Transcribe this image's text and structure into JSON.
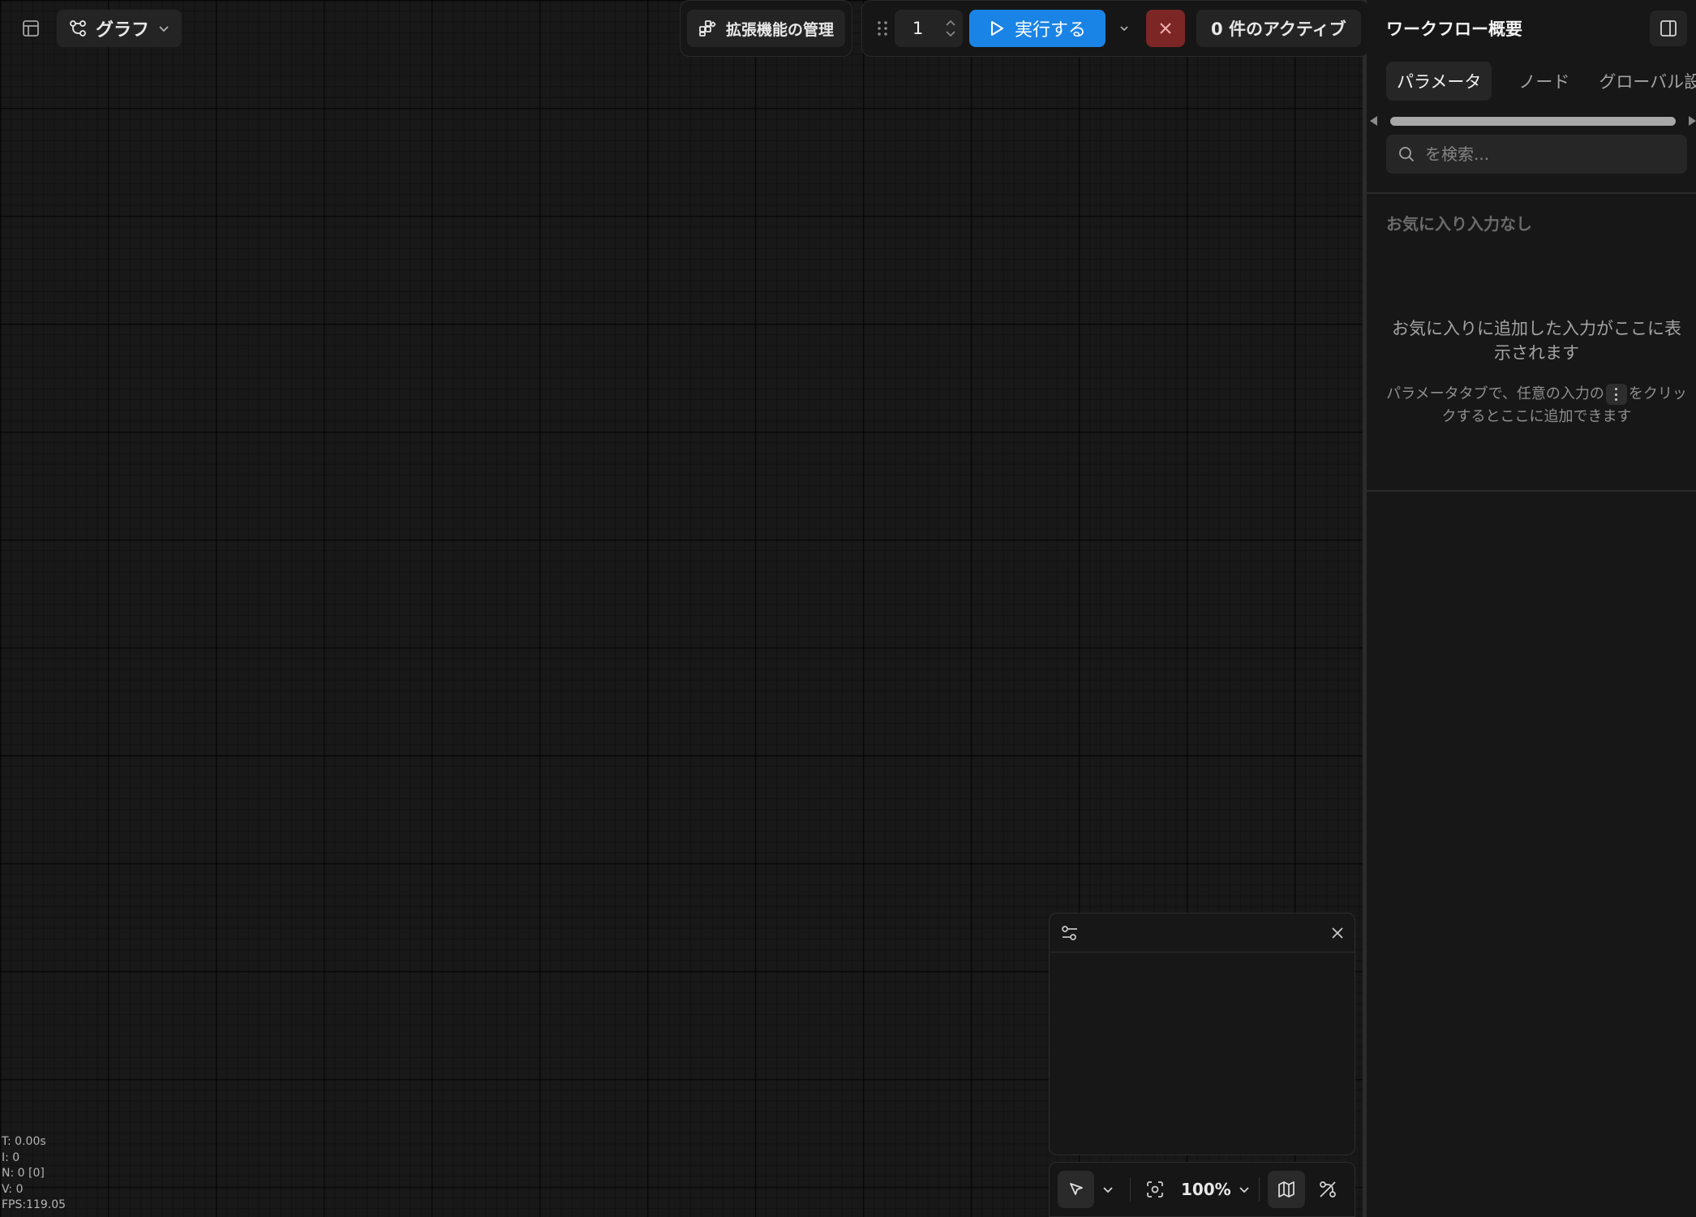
{
  "toolbar": {
    "graph_label": "グラフ",
    "extensions_label": "拡張機能の管理",
    "batch_count": "1",
    "run_label": "実行する",
    "active_label": "0 件のアクティブ"
  },
  "panel": {
    "title": "ワークフロー概要",
    "tabs": [
      "パラメータ",
      "ノード",
      "グローバル設定"
    ],
    "search_placeholder": "を検索...",
    "favorites_heading": "お気に入り入力なし",
    "empty_title": "お気に入りに追加した入力がここに表示されます",
    "hint_before": "パラメータタブで、任意の入力の",
    "hint_after": "をクリックするとここに追加できます"
  },
  "canvas": {
    "zoom": "100%"
  },
  "stats": {
    "time": "T: 0.00s",
    "iterations": "I: 0",
    "nodes": "N: 0 [0]",
    "vertices": "V: 0",
    "fps": "FPS:119.05"
  },
  "colors": {
    "accent": "#1a84e6",
    "danger": "#7d2626",
    "background": "#171717"
  }
}
